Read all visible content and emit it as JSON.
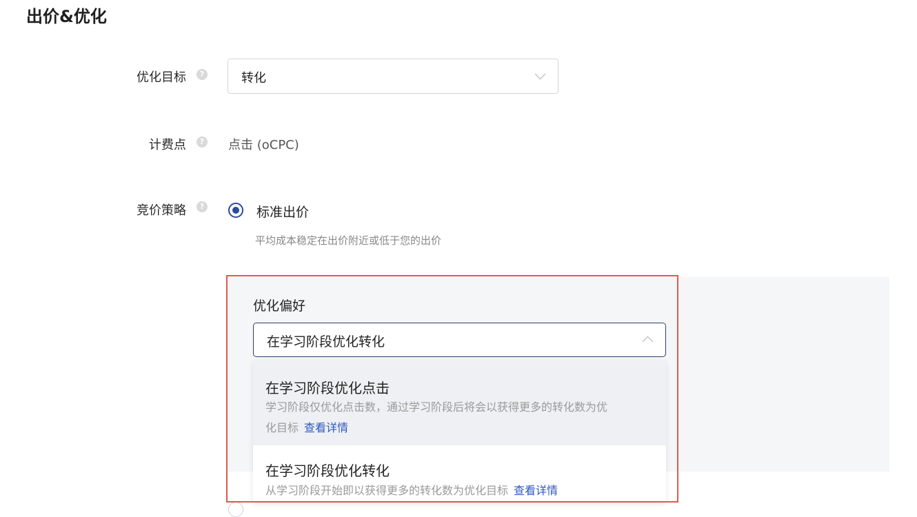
{
  "page": {
    "title": "出价&优化"
  },
  "optimization_goal": {
    "label": "优化目标",
    "value": "转化"
  },
  "billing_point": {
    "label": "计费点",
    "value": "点击 (oCPC)"
  },
  "bid_strategy": {
    "label": "竞价策略",
    "option_label": "标准出价",
    "option_desc": "平均成本稳定在出价附近或低于您的出价"
  },
  "preference": {
    "label": "优化偏好",
    "selected": "在学习阶段优化转化",
    "options": [
      {
        "title": "在学习阶段优化点击",
        "desc_line1": "学习阶段仅优化点击数，通过学习阶段后将会以获得更多的转化数为优",
        "desc_line2": "化目标",
        "link": "查看详情"
      },
      {
        "title": "在学习阶段优化转化",
        "desc": "从学习阶段开始即以获得更多的转化数为优化目标",
        "link": "查看详情"
      }
    ]
  },
  "icons": {
    "help": "question-circle-icon",
    "chevron_down": "chevron-down-icon",
    "chevron_up": "chevron-up-icon"
  },
  "colors": {
    "accent": "#2b4aa0",
    "link": "#2d57c4",
    "highlight_border": "#e0574f"
  }
}
